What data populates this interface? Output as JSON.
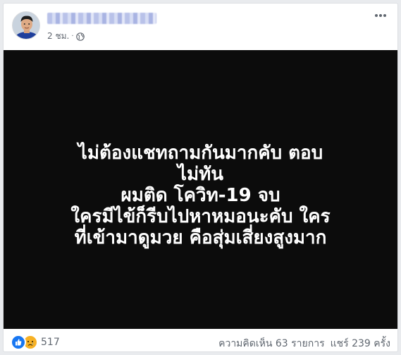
{
  "post": {
    "timestamp": "2 ชม.",
    "separator": "·",
    "privacy_icon": "globe-icon",
    "more_icon": "more-horizontal-icon",
    "text_lines": [
      "ไม่ต้องแชทถามกันมากคับ ตอบ",
      "ไม่ทัน",
      "ผมติด โควิท-19 จบ",
      "ใครมีไข้ก็รีบไปหาหมอนะคับ ใคร",
      "ที่เข้ามาดูมวย คือสุ่มเสี่ยงสูงมาก"
    ],
    "background_color": "#0c0c0c",
    "text_color": "#ffffff"
  },
  "footer": {
    "reaction_icons": [
      "like-icon",
      "sad-icon"
    ],
    "reaction_count": "517",
    "comments_label": "ความคิดเห็น 63 รายการ",
    "shares_label": "แชร์ 239 ครั้ง"
  },
  "colors": {
    "like": "#1877f2",
    "sad": "#f7b125",
    "meta_text": "#616770"
  }
}
